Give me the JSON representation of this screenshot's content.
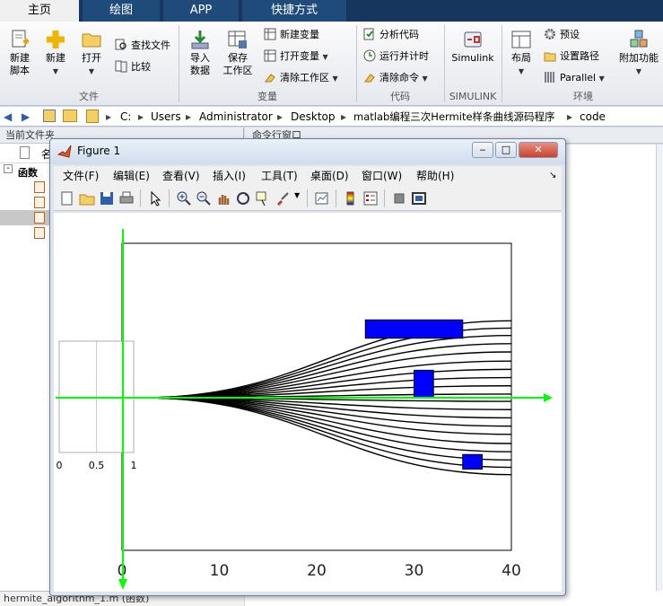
{
  "tabs": [
    "主页",
    "绘图",
    "APP",
    "快捷方式"
  ],
  "ribbon": {
    "new_script": "新建\n脚本",
    "new": "新建",
    "open": "打开",
    "find_files": "查找文件",
    "compare": "比较",
    "import_data": "导入\n数据",
    "save_workspace": "保存\n工作区",
    "new_variable": "新建变量",
    "open_variable": "打开变量",
    "clear_workspace": "清除工作区",
    "analyze_code": "分析代码",
    "run_and_time": "运行并计时",
    "clear_commands": "清除命令",
    "simulink": "Simulink",
    "layout": "布局",
    "preferences": "预设",
    "set_path": "设置路径",
    "parallel": "Parallel",
    "add_ons": "附加功能",
    "groups": {
      "file": "文件",
      "variable": "变量",
      "code": "代码",
      "simulink": "SIMULINK",
      "environment": "环境"
    }
  },
  "address": {
    "crumbs": [
      "C:",
      "Users",
      "Administrator",
      "Desktop",
      "matlab编程三次Hermite样条曲线源码程序",
      "code"
    ]
  },
  "left_panel": {
    "title": "当前文件夹",
    "col_name": "名",
    "group_label": "函数",
    "status": "hermite_algorithm_1.m  (函数)"
  },
  "command_window": {
    "title": "命令行窗口"
  },
  "figure": {
    "title": "Figure 1",
    "menus": [
      "文件(F)",
      "编辑(E)",
      "查看(V)",
      "插入(I)",
      "工具(T)",
      "桌面(D)",
      "窗口(W)",
      "帮助(H)"
    ],
    "inset_xticks": [
      "0",
      "0.5",
      "1"
    ],
    "main_xticks": [
      "0",
      "10",
      "20",
      "30",
      "40"
    ]
  },
  "chart_data": {
    "type": "line",
    "title": "",
    "xlabel": "",
    "ylabel": "",
    "xlim": [
      0,
      40
    ],
    "curve_start": [
      2,
      0
    ],
    "curve_end_x": 40,
    "curve_end_y": [
      -8.4,
      -7.6,
      -6.8,
      -5.9,
      -5.0,
      -4.0,
      -3.1,
      -2.2,
      -1.3,
      -0.4,
      0.4,
      1.3,
      2.2,
      3.1,
      4.0,
      5.0,
      5.9,
      6.8,
      7.6,
      8.4
    ],
    "obstacles": [
      {
        "x": [
          25,
          35
        ],
        "y": [
          6.5,
          8.5
        ],
        "color": "#0000ff"
      },
      {
        "x": [
          30,
          32
        ],
        "y": [
          0,
          3
        ],
        "color": "#0000ff"
      },
      {
        "x": [
          35,
          37
        ],
        "y": [
          -7.8,
          -6.2
        ],
        "color": "#0000ff"
      }
    ],
    "axis_arrow_color": "#00ff00",
    "curve_color": "#000000"
  }
}
